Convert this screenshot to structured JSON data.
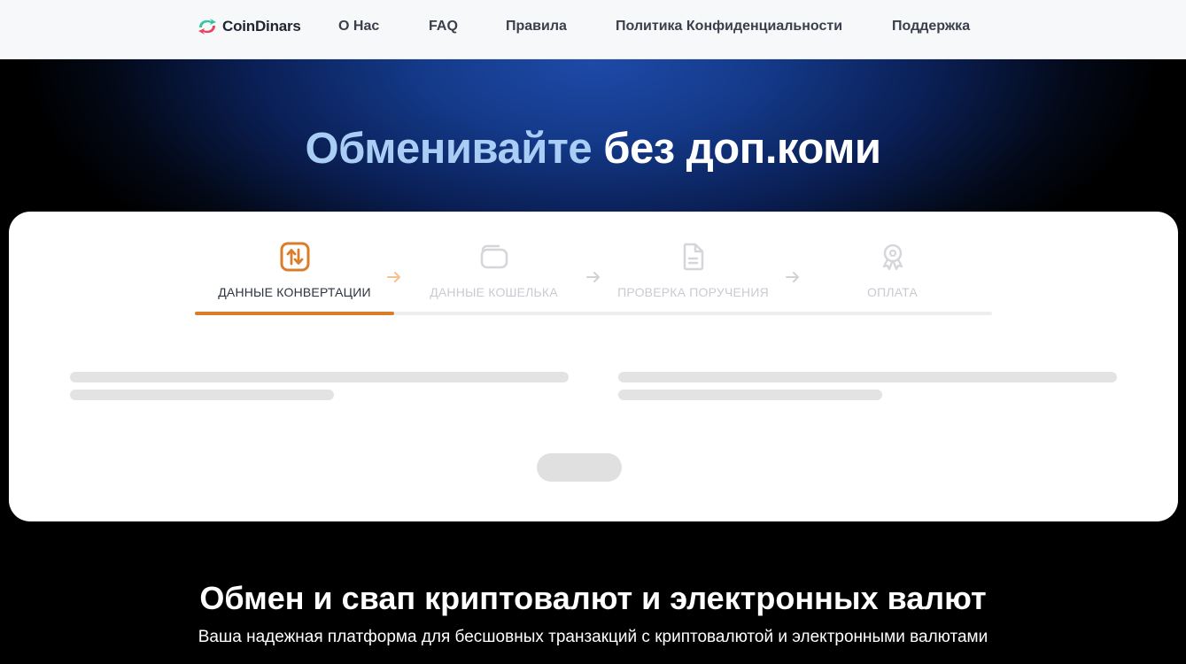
{
  "brand": {
    "name": "CoinDinars"
  },
  "nav": {
    "items": [
      {
        "label": "О Нас"
      },
      {
        "label": "FAQ"
      },
      {
        "label": "Правила"
      },
      {
        "label": "Политика Конфиденциальности"
      },
      {
        "label": "Поддержка"
      }
    ]
  },
  "hero": {
    "title_highlight": "Обменивайте",
    "title_rest": "без доп.коми"
  },
  "wizard": {
    "steps": [
      {
        "label": "ДАННЫЕ КОНВЕРТАЦИИ",
        "icon": "swap-arrows-icon",
        "state": "active"
      },
      {
        "label": "ДАННЫЕ КОШЕЛЬКА",
        "icon": "wallet-icon",
        "state": "inactive"
      },
      {
        "label": "ПРОВЕРКА ПОРУЧЕНИЯ",
        "icon": "document-icon",
        "state": "inactive"
      },
      {
        "label": "ОПЛАТА",
        "icon": "award-icon",
        "state": "inactive"
      }
    ],
    "progress_fraction": 0.25,
    "accent_color": "#d97d2a"
  },
  "section": {
    "title": "Обмен и свап криптовалют и электронных валют",
    "subtitle": "Ваша надежная платформа для бесшовных транзакций с криптовалютой и электронными валютами"
  }
}
